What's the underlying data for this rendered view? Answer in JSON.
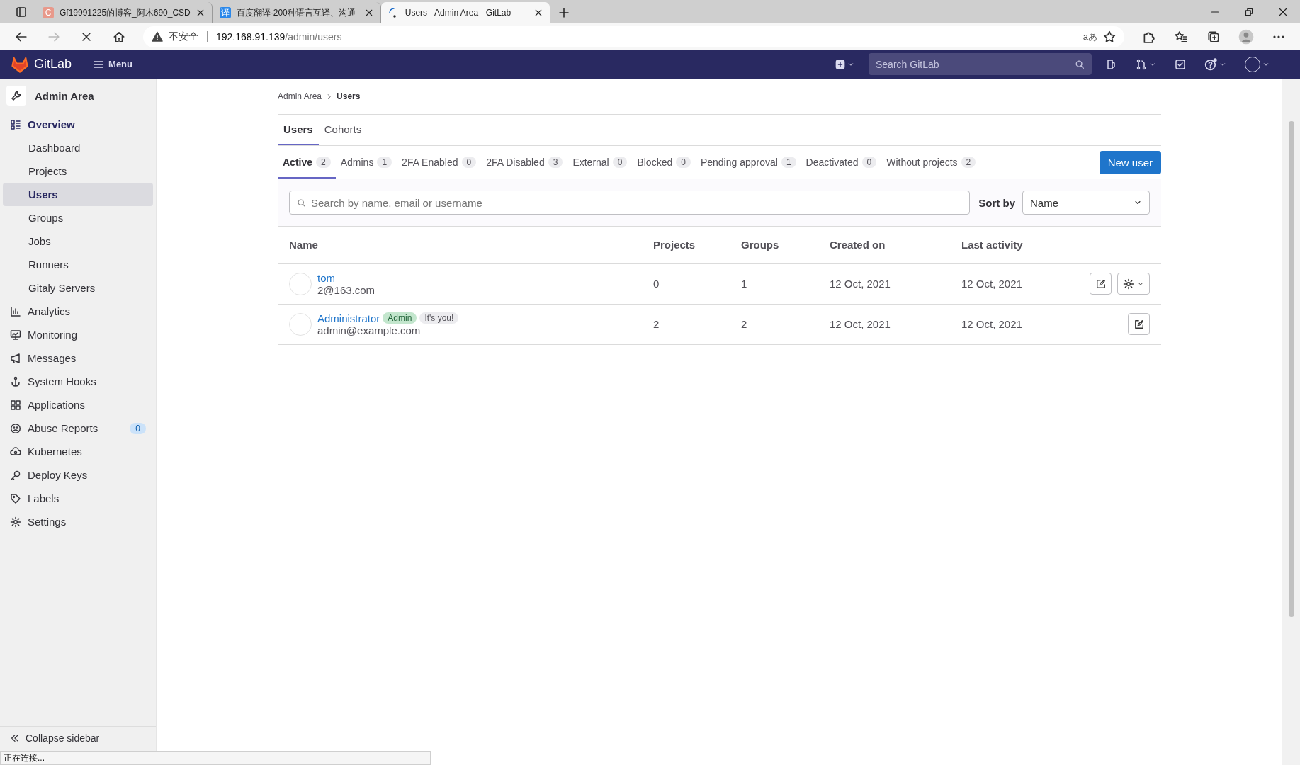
{
  "browser": {
    "tabs": [
      {
        "title": "Gf19991225的博客_阿木690_CSD",
        "icon_text": "C",
        "color": "#e8998b",
        "selected": false
      },
      {
        "title": "百度翻译-200种语言互译、沟通",
        "icon_text": "译",
        "color": "#2b88ea",
        "selected": false
      },
      {
        "title": "Users · Admin Area · GitLab",
        "selected": true
      }
    ],
    "address": {
      "warning": "不安全",
      "host": "192.168.91.139",
      "path": "/admin/users"
    },
    "translate_label": "aあ",
    "status_text": "正在连接..."
  },
  "header": {
    "brand": "GitLab",
    "menu": "Menu",
    "search_placeholder": "Search GitLab"
  },
  "sidebar": {
    "title": "Admin Area",
    "items": [
      {
        "label": "Overview",
        "selected": false,
        "expanded": true,
        "children": [
          {
            "label": "Dashboard",
            "selected": false
          },
          {
            "label": "Projects",
            "selected": false
          },
          {
            "label": "Users",
            "selected": true
          },
          {
            "label": "Groups",
            "selected": false
          },
          {
            "label": "Jobs",
            "selected": false
          },
          {
            "label": "Runners",
            "selected": false
          },
          {
            "label": "Gitaly Servers",
            "selected": false
          }
        ]
      },
      {
        "label": "Analytics",
        "selected": false
      },
      {
        "label": "Monitoring",
        "selected": false
      },
      {
        "label": "Messages",
        "selected": false
      },
      {
        "label": "System Hooks",
        "selected": false
      },
      {
        "label": "Applications",
        "selected": false
      },
      {
        "label": "Abuse Reports",
        "selected": false,
        "badge": "0"
      },
      {
        "label": "Kubernetes",
        "selected": false
      },
      {
        "label": "Deploy Keys",
        "selected": false
      },
      {
        "label": "Labels",
        "selected": false
      },
      {
        "label": "Settings",
        "selected": false
      }
    ],
    "collapse": "Collapse sidebar"
  },
  "breadcrumb": [
    "Admin Area",
    "Users"
  ],
  "tabs": [
    {
      "label": "Users",
      "selected": true
    },
    {
      "label": "Cohorts",
      "selected": false
    }
  ],
  "filter_tabs": [
    {
      "label": "Active",
      "count": "2",
      "selected": true
    },
    {
      "label": "Admins",
      "count": "1",
      "selected": false
    },
    {
      "label": "2FA Enabled",
      "count": "0",
      "selected": false
    },
    {
      "label": "2FA Disabled",
      "count": "3",
      "selected": false
    },
    {
      "label": "External",
      "count": "0",
      "selected": false
    },
    {
      "label": "Blocked",
      "count": "0",
      "selected": false
    },
    {
      "label": "Pending approval",
      "count": "1",
      "selected": false
    },
    {
      "label": "Deactivated",
      "count": "0",
      "selected": false
    },
    {
      "label": "Without projects",
      "count": "2",
      "selected": false
    }
  ],
  "new_user_button": "New user",
  "search": {
    "placeholder": "Search by name, email or username"
  },
  "sort": {
    "label": "Sort by",
    "value": "Name"
  },
  "table": {
    "columns": [
      "Name",
      "Projects",
      "Groups",
      "Created on",
      "Last activity"
    ],
    "rows": [
      {
        "name": "tom",
        "email": "2@163.com",
        "badges": [],
        "projects": "0",
        "groups": "1",
        "created_on": "12 Oct, 2021",
        "last_activity": "12 Oct, 2021",
        "settings_menu": true
      },
      {
        "name": "Administrator",
        "email": "admin@example.com",
        "badges": [
          {
            "label": "Admin",
            "kind": "success"
          },
          {
            "label": "It's you!",
            "kind": "neutral"
          }
        ],
        "projects": "2",
        "groups": "2",
        "created_on": "12 Oct, 2021",
        "last_activity": "12 Oct, 2021",
        "settings_menu": false
      }
    ]
  }
}
